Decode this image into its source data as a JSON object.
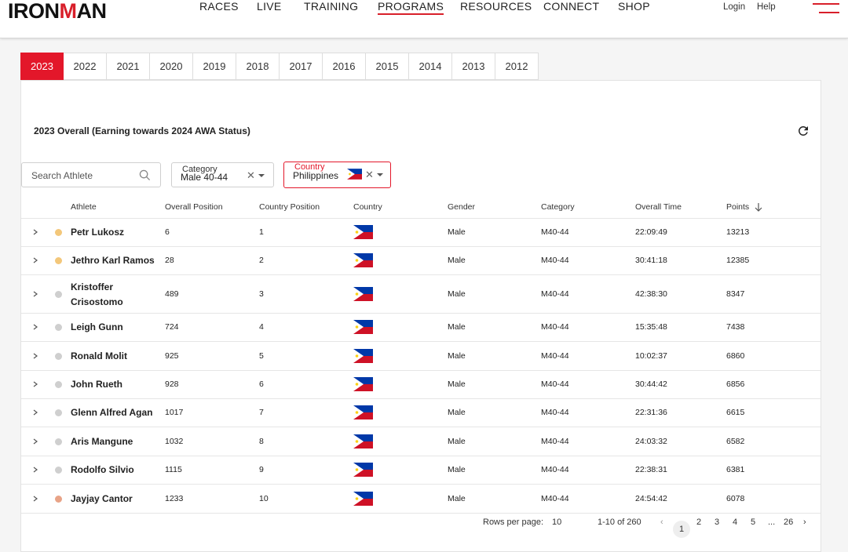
{
  "nav": {
    "logo_pre": "IRON",
    "logo_m": "M",
    "logo_post": "AN",
    "items": [
      "RACES",
      "LIVE",
      "TRAINING",
      "PROGRAMS",
      "RESOURCES",
      "CONNECT",
      "SHOP"
    ],
    "active_item": "PROGRAMS",
    "login": "Login",
    "help": "Help"
  },
  "year_tabs": [
    "2023",
    "2022",
    "2021",
    "2020",
    "2019",
    "2018",
    "2017",
    "2016",
    "2015",
    "2014",
    "2013",
    "2012"
  ],
  "active_year": "2023",
  "panel": {
    "title": "2023 Overall (Earning towards 2024 AWA Status)"
  },
  "filters": {
    "search_placeholder": "Search Athlete",
    "category_label": "Category",
    "category_value": "Male 40-44",
    "country_label": "Country",
    "country_value": "Philippines"
  },
  "table": {
    "headers": [
      "Athlete",
      "Overall Position",
      "Country Position",
      "Country",
      "Gender",
      "Category",
      "Overall Time",
      "Points"
    ],
    "rows": [
      {
        "name": "Petr Lukosz",
        "overall": "6",
        "country_pos": "1",
        "gender": "Male",
        "category": "M40-44",
        "time": "22:09:49",
        "points": "13213",
        "dot": "#f3c77a"
      },
      {
        "name": "Jethro Karl Ramos",
        "overall": "28",
        "country_pos": "2",
        "gender": "Male",
        "category": "M40-44",
        "time": "30:41:18",
        "points": "12385",
        "dot": "#f3c77a"
      },
      {
        "name": "Kristoffer Crisostomo",
        "name_line1": "Kristoffer",
        "name_line2": "Crisostomo",
        "overall": "489",
        "country_pos": "3",
        "gender": "Male",
        "category": "M40-44",
        "time": "42:38:30",
        "points": "8347",
        "dot": "#cfcfcf"
      },
      {
        "name": "Leigh Gunn",
        "overall": "724",
        "country_pos": "4",
        "gender": "Male",
        "category": "M40-44",
        "time": "15:35:48",
        "points": "7438",
        "dot": "#cfcfcf"
      },
      {
        "name": "Ronald Molit",
        "overall": "925",
        "country_pos": "5",
        "gender": "Male",
        "category": "M40-44",
        "time": "10:02:37",
        "points": "6860",
        "dot": "#cfcfcf"
      },
      {
        "name": "John Rueth",
        "overall": "928",
        "country_pos": "6",
        "gender": "Male",
        "category": "M40-44",
        "time": "30:44:42",
        "points": "6856",
        "dot": "#cfcfcf"
      },
      {
        "name": "Glenn Alfred Agan",
        "overall": "1017",
        "country_pos": "7",
        "gender": "Male",
        "category": "M40-44",
        "time": "22:31:36",
        "points": "6615",
        "dot": "#cfcfcf"
      },
      {
        "name": "Aris Mangune",
        "overall": "1032",
        "country_pos": "8",
        "gender": "Male",
        "category": "M40-44",
        "time": "24:03:32",
        "points": "6582",
        "dot": "#cfcfcf"
      },
      {
        "name": "Rodolfo Silvio",
        "overall": "1115",
        "country_pos": "9",
        "gender": "Male",
        "category": "M40-44",
        "time": "22:38:31",
        "points": "6381",
        "dot": "#cfcfcf"
      },
      {
        "name": "Jayjay Cantor",
        "overall": "1233",
        "country_pos": "10",
        "gender": "Male",
        "category": "M40-44",
        "time": "24:54:42",
        "points": "6078",
        "dot": "#e8a387"
      }
    ]
  },
  "pagination": {
    "rows_label": "Rows per page:",
    "rows_value": "10",
    "range": "1-10 of 260",
    "pages": [
      "1",
      "2",
      "3",
      "4",
      "5",
      "...",
      "26"
    ]
  },
  "colors": {
    "accent": "#e3172a",
    "gold": "#f3c77a",
    "bronze": "#e8a387",
    "grey": "#cfcfcf"
  }
}
